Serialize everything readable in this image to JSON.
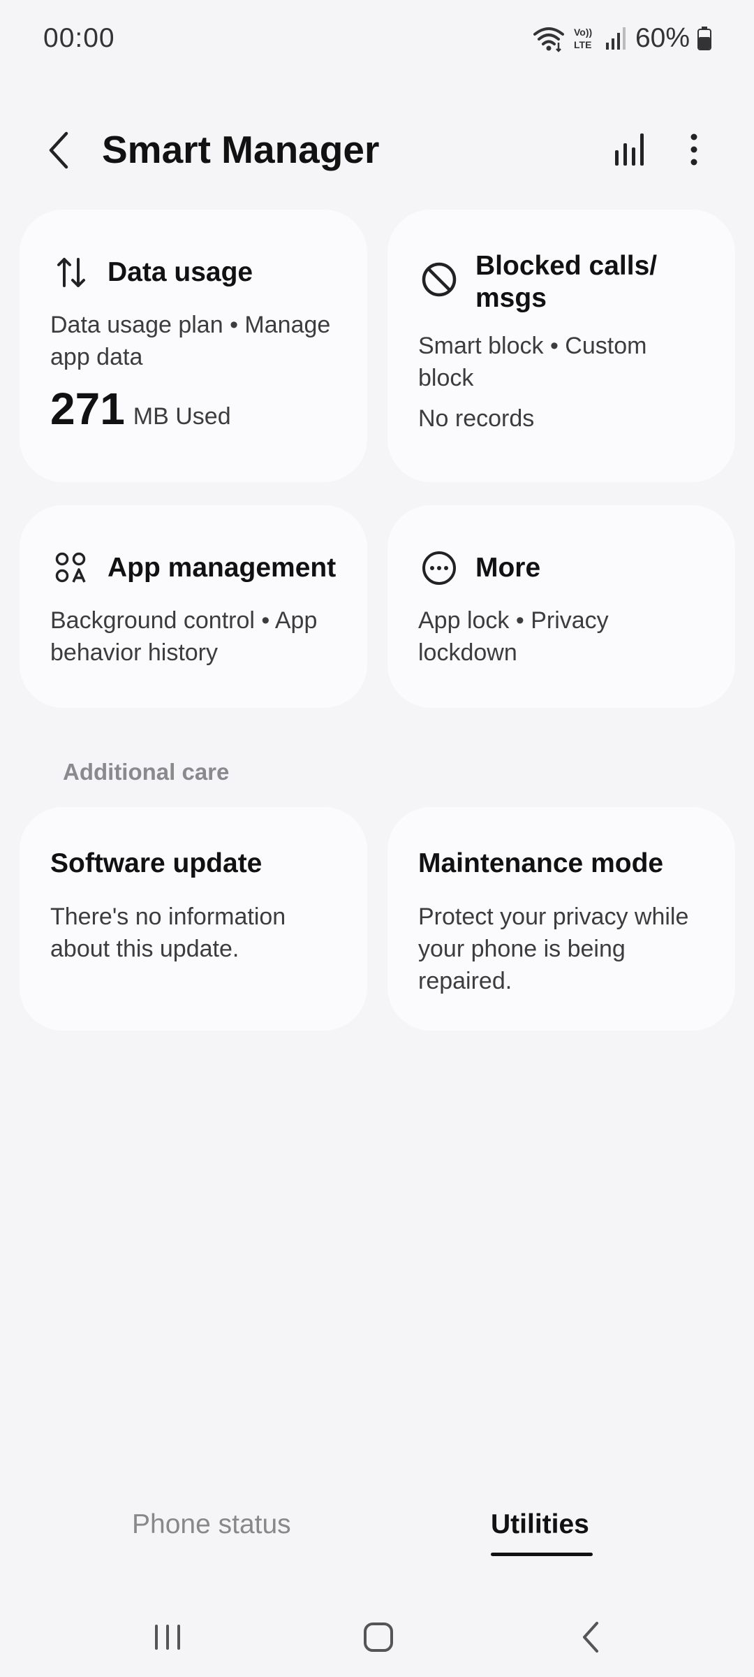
{
  "status_bar": {
    "time": "00:00",
    "battery_percent": "60%",
    "icons": [
      "wifi-icon",
      "volte-icon",
      "signal-icon",
      "battery-icon"
    ]
  },
  "header": {
    "title": "Smart Manager",
    "back_icon": "back-arrow-icon",
    "actions": [
      "stats-icon",
      "more-options-icon"
    ]
  },
  "cards": {
    "data_usage": {
      "title": "Data usage",
      "desc": "Data usage plan • Manage app data",
      "value": "271",
      "unit": "MB Used",
      "icon": "data-transfer-icon"
    },
    "blocked": {
      "title": "Blocked calls/ msgs",
      "desc": "Smart block • Custom block",
      "sub": "No records",
      "icon": "block-icon"
    },
    "app_management": {
      "title": "App management",
      "desc": "Background control • App behavior history",
      "icon": "apps-icon"
    },
    "more": {
      "title": "More",
      "desc": "App lock • Privacy lockdown",
      "icon": "more-circle-icon"
    }
  },
  "additional_care": {
    "label": "Additional care",
    "software_update": {
      "title": "Software update",
      "desc": "There's no information about this update."
    },
    "maintenance_mode": {
      "title": "Maintenance mode",
      "desc": "Protect your privacy while your phone is being repaired."
    }
  },
  "tabs": {
    "phone_status": "Phone status",
    "utilities": "Utilities",
    "selected": "Utilities"
  },
  "navbar": {
    "icons": [
      "recent-apps-icon",
      "home-icon",
      "nav-back-icon"
    ]
  }
}
